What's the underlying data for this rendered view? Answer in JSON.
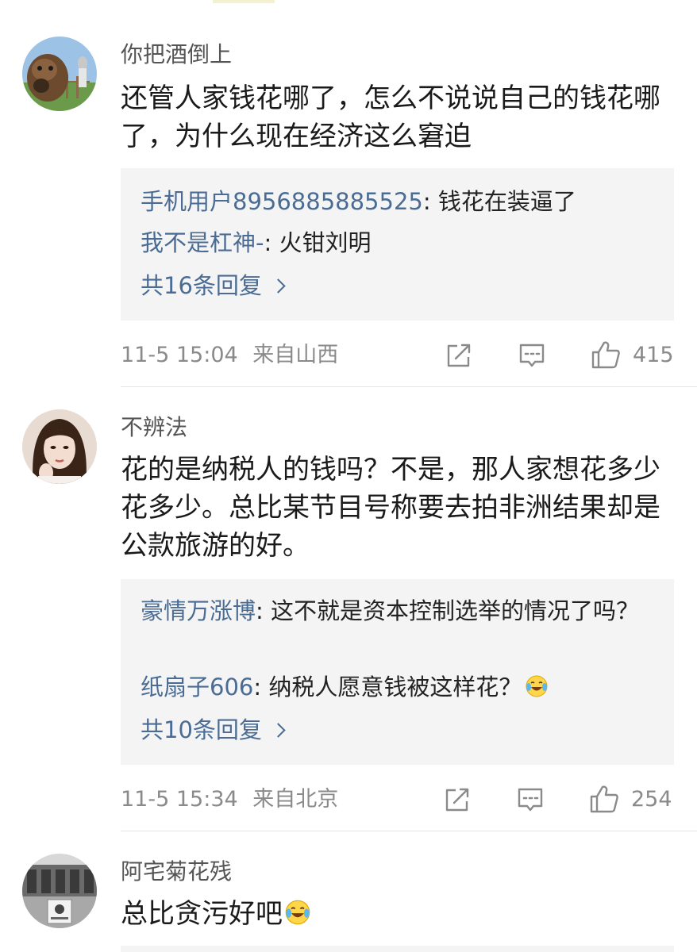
{
  "comments": [
    {
      "username": "你把酒倒上",
      "text": "还管人家钱花哪了，怎么不说说自己的钱花哪了，为什么现在经济这么窘迫",
      "replies": [
        {
          "user": "手机用户8956885885525",
          "text": "钱花在装逼了"
        },
        {
          "user": "我不是杠神-",
          "text": "火钳刘明"
        }
      ],
      "more_replies": "共16条回复",
      "time": "11-5 15:04",
      "location": "来自山西",
      "likes": "415"
    },
    {
      "username": "不辨法",
      "text": "花的是纳税人的钱吗？不是，那人家想花多少花多少。总比某节目号称要去拍非洲结果却是公款旅游的好。",
      "replies": [
        {
          "user": "豪情万涨博",
          "text": "这不就是资本控制选举的情况了吗？"
        },
        {
          "user": "纸扇子606",
          "text": "纳税人愿意钱被这样花？"
        }
      ],
      "more_replies": "共10条回复",
      "time": "11-5 15:34",
      "location": "来自北京",
      "likes": "254"
    },
    {
      "username": "阿宅菊花残",
      "text": "总比贪污好吧"
    }
  ],
  "colors": {
    "link": "#4a6c94",
    "meta": "#8a8a8a",
    "reply_bg": "#f4f4f4"
  },
  "icons": {
    "share": "share-icon",
    "comment": "comment-icon",
    "like": "thumbs-up-icon",
    "emoji": "laugh-cry-emoji-icon",
    "chevron": "chevron-right-icon"
  }
}
